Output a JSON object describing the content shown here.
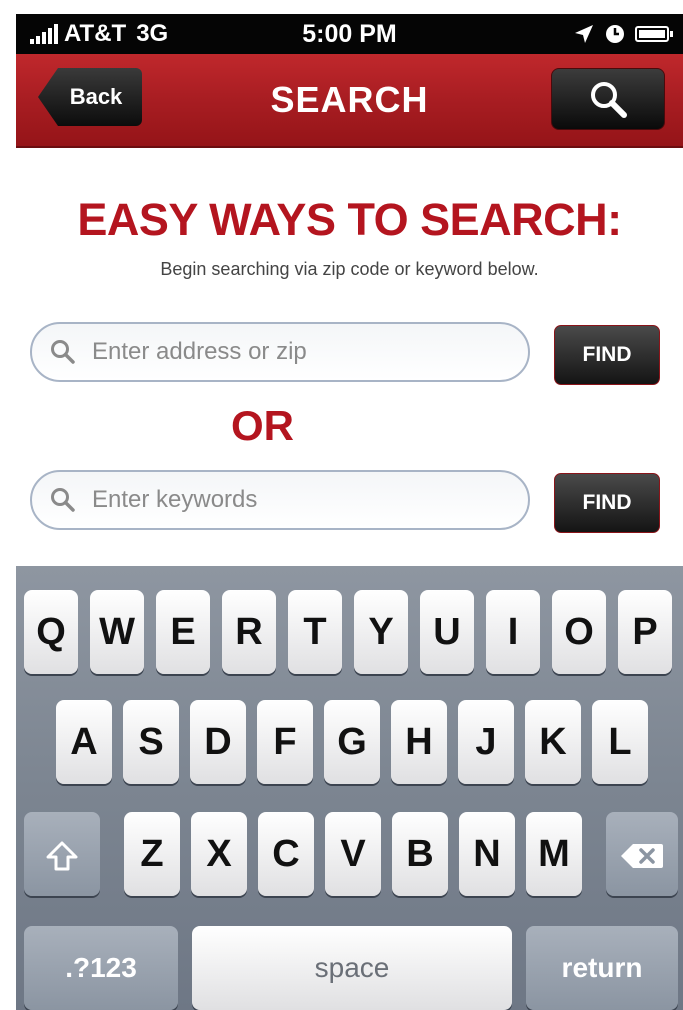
{
  "status_bar": {
    "carrier": "AT&T",
    "network": "3G",
    "time": "5:00 PM"
  },
  "navbar": {
    "back_label": "Back",
    "title": "SEARCH"
  },
  "content": {
    "headline": "EASY WAYS TO SEARCH:",
    "subtext": "Begin searching via zip code or keyword below.",
    "address_field": {
      "placeholder": "Enter address or zip",
      "value": "",
      "find_label": "FIND"
    },
    "or_label": "OR",
    "keyword_field": {
      "placeholder": "Enter keywords",
      "value": "",
      "find_label": "FIND"
    }
  },
  "keyboard": {
    "row1": [
      "Q",
      "W",
      "E",
      "R",
      "T",
      "Y",
      "U",
      "I",
      "O",
      "P"
    ],
    "row2": [
      "A",
      "S",
      "D",
      "F",
      "G",
      "H",
      "J",
      "K",
      "L"
    ],
    "row3": [
      "Z",
      "X",
      "C",
      "V",
      "B",
      "N",
      "M"
    ],
    "numbers_label": ".?123",
    "space_label": "space",
    "return_label": "return"
  },
  "colors": {
    "brand_red": "#b4151f",
    "navbar_red": "#a81d22",
    "keyboard_bg": "#7c8591"
  },
  "icons": [
    "signal-bars-icon",
    "location-arrow-icon",
    "clock-icon",
    "battery-icon",
    "search-icon",
    "shift-icon",
    "backspace-icon"
  ]
}
